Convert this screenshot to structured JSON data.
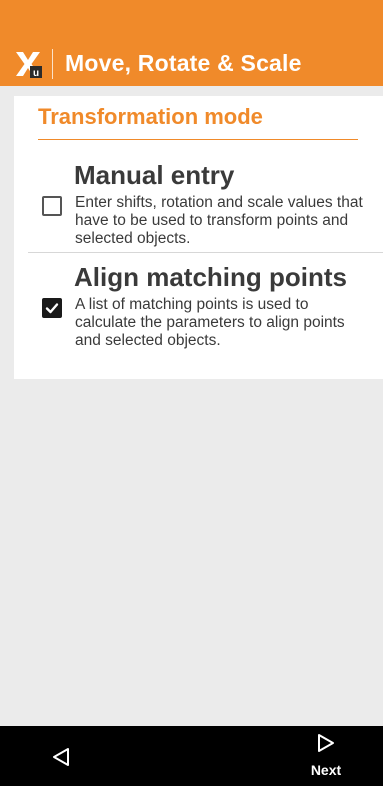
{
  "app_bar": {
    "title": "Move, Rotate & Scale",
    "logo_icon": "app-logo-icon",
    "color": "#f08a2a"
  },
  "section": {
    "title": "Transformation mode"
  },
  "options": [
    {
      "title": "Manual entry",
      "description": "Enter shifts, rotation and scale values that have to be used to transform points and selected objects.",
      "checked": false
    },
    {
      "title": "Align matching points",
      "description": "A list of matching points is used to calculate the parameters to align points and selected objects.",
      "checked": true
    }
  ],
  "nav": {
    "back_icon": "back-triangle-icon",
    "next_icon": "next-triangle-icon",
    "next_label": "Next"
  }
}
